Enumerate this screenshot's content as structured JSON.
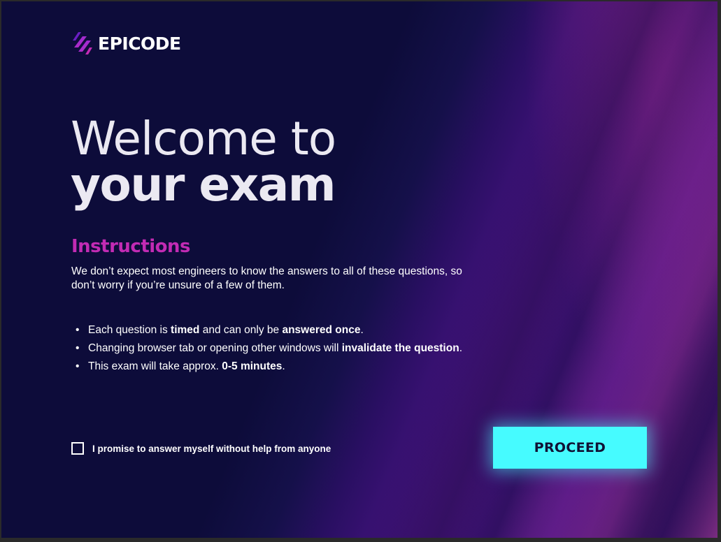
{
  "brand": {
    "name": "EPICODE",
    "icon": "epicode-logo-icon"
  },
  "headline": {
    "line1": "Welcome to",
    "line2": "your exam"
  },
  "instructions": {
    "title": "Instructions",
    "intro": "We don’t expect most engineers to know the answers to all of these questions, so don’t worry if you’re unsure of a few of them.",
    "rules": [
      {
        "a": "Each question is ",
        "b1": "timed",
        "c": " and can only be ",
        "b2": "answered once",
        "d": "."
      },
      {
        "a": "Changing browser tab or opening other windows will ",
        "b1": "invalidate the question",
        "c": "",
        "b2": "",
        "d": "."
      },
      {
        "a": "This exam will take approx. ",
        "b1": "0-5 minutes",
        "c": "",
        "b2": "",
        "d": "."
      }
    ]
  },
  "promise": {
    "label": "I promise to answer myself without help from anyone",
    "checked": false
  },
  "proceed": {
    "label": "PROCEED"
  },
  "colors": {
    "background": "#0d0c3a",
    "accent_magenta": "#c22bb4",
    "button_cyan": "#46fbff"
  }
}
